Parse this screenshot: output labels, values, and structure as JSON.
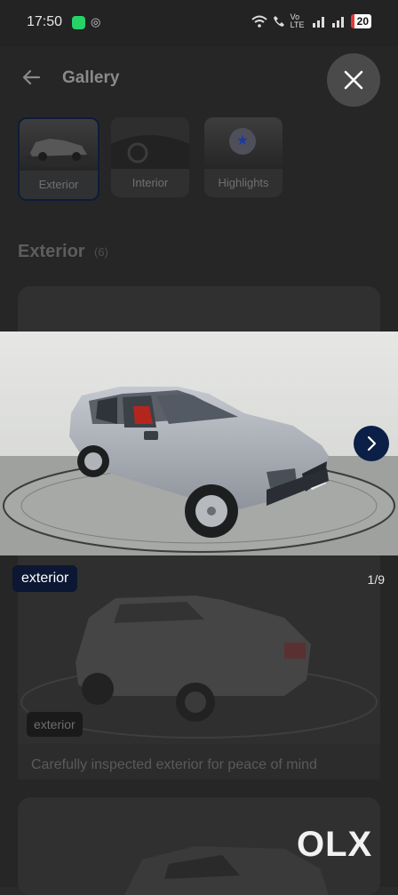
{
  "status_bar": {
    "time": "17:50",
    "network_label": "Vo LTE",
    "battery": "20",
    "icons": [
      "whatsapp-icon",
      "at-icon",
      "wifi-icon",
      "call-icon",
      "signal-icon"
    ]
  },
  "header": {
    "title": "Gallery",
    "back_icon": "arrow-left-icon",
    "close_icon": "close-icon"
  },
  "tabs": [
    {
      "label": "Exterior",
      "active": true
    },
    {
      "label": "Interior",
      "active": false
    },
    {
      "label": "Highlights",
      "active": false
    }
  ],
  "section": {
    "title": "Exterior",
    "count": "(6)"
  },
  "viewer": {
    "badge": "exterior",
    "counter": "1/9",
    "next_icon": "chevron-right-icon"
  },
  "card": {
    "badge": "exterior",
    "caption": "Carefully inspected exterior for peace of mind"
  },
  "brand": {
    "logo": "OLX"
  },
  "colors": {
    "accent_navy": "#0b1f47",
    "badge_navy": "#0b1733",
    "battery_red": "#e53935",
    "whatsapp_green": "#25d366"
  }
}
